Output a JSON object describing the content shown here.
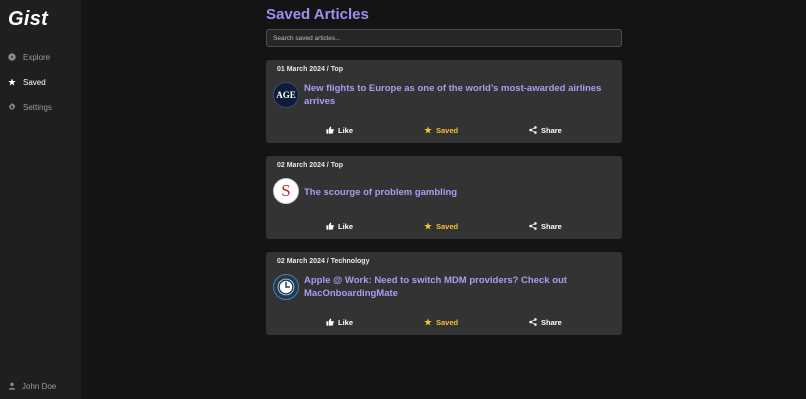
{
  "app": {
    "name": "Gist"
  },
  "sidebar": {
    "items": [
      {
        "label": "Explore",
        "icon": "compass-icon",
        "active": false
      },
      {
        "label": "Saved",
        "icon": "star-icon",
        "active": true
      },
      {
        "label": "Settings",
        "icon": "gear-icon",
        "active": false
      }
    ],
    "user": {
      "name": "John Doe",
      "icon": "user-icon"
    }
  },
  "main": {
    "title": "Saved Articles",
    "search": {
      "placeholder": "Search saved articles...",
      "value": ""
    },
    "articles": [
      {
        "meta": "01 March 2024 / Top",
        "source_logo_text": "AGE",
        "title": "New flights to Europe as one of the world’s most-awarded airlines arrives"
      },
      {
        "meta": "02 March 2024 / Top",
        "source_logo_text": "S",
        "title": "The scourge of problem gambling"
      },
      {
        "meta": "02 March 2024 / Technology",
        "source_logo_text": "",
        "title": "Apple @ Work: Need to switch MDM providers? Check out MacOnboardingMate"
      }
    ],
    "actions": {
      "like": "Like",
      "saved": "Saved",
      "share": "Share"
    }
  },
  "colors": {
    "accent": "#9d8fef",
    "headline": "#a89df3",
    "saved": "#f2c030",
    "card": "#333333",
    "sidebar": "#1f1f1f",
    "background": "#141414"
  }
}
